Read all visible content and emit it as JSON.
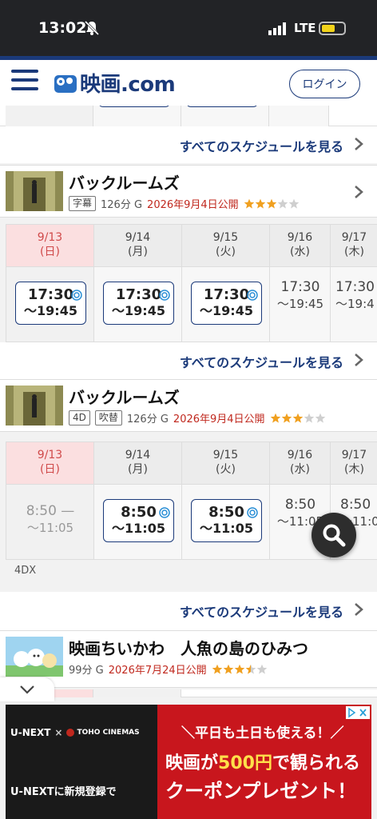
{
  "status": {
    "time": "13:02",
    "network": "LTE"
  },
  "header": {
    "logo_text": "映画.com",
    "login_label": "ログイン"
  },
  "more_label": "すべてのスケジュールを見る",
  "days": [
    {
      "date": "9/13",
      "dow": "(日)"
    },
    {
      "date": "9/14",
      "dow": "(月)"
    },
    {
      "date": "9/15",
      "dow": "(火)"
    },
    {
      "date": "9/16",
      "dow": "(水)"
    },
    {
      "date": "9/17",
      "dow": "(木)"
    }
  ],
  "movies": [
    {
      "title": "バックルームズ",
      "tag1": "字幕",
      "meta": "126分 G",
      "release": "2026年9月4日公開",
      "rating": 3,
      "slots": [
        {
          "start": "17:30",
          "end": "〜19:45"
        },
        {
          "start": "17:30",
          "end": "〜19:45"
        },
        {
          "start": "17:30",
          "end": "〜19:45"
        },
        {
          "start": "17:30",
          "end": "〜19:45"
        },
        {
          "start": "17:30",
          "end": "〜19:4"
        }
      ]
    },
    {
      "title": "バックルームズ",
      "tag1": "4D",
      "tag2": "吹替",
      "meta": "126分 G",
      "release": "2026年9月4日公開",
      "rating": 3,
      "format": "4DX",
      "slots": [
        {
          "start": "8:50 —",
          "end": "〜11:05"
        },
        {
          "start": "8:50",
          "end": "〜11:05"
        },
        {
          "start": "8:50",
          "end": "〜11:05"
        },
        {
          "start": "8:50",
          "end": "〜11:05"
        },
        {
          "start": "8:50",
          "end": "〜11:0"
        }
      ]
    },
    {
      "title": "映画ちいかわ　人魚の島のひみつ",
      "meta": "99分 G",
      "release": "2026年7月24日公開",
      "rating": 3.5
    }
  ],
  "ad": {
    "brand1": "U-NEXT",
    "x": "×",
    "brand2": "TOHO CINEMAS",
    "cta": "U-NEXTに新規登録で",
    "line1": "＼平日も土日も使える！／",
    "line2a": "映画が",
    "line2b": "500円",
    "line2c": "で観られる",
    "line3": "クーポンプレゼント！"
  },
  "colors": {
    "brand_navy": "#1b3a7a",
    "release_red": "#c0281e",
    "today_pink": "#fbdfe0",
    "star_gold": "#f0a020"
  }
}
